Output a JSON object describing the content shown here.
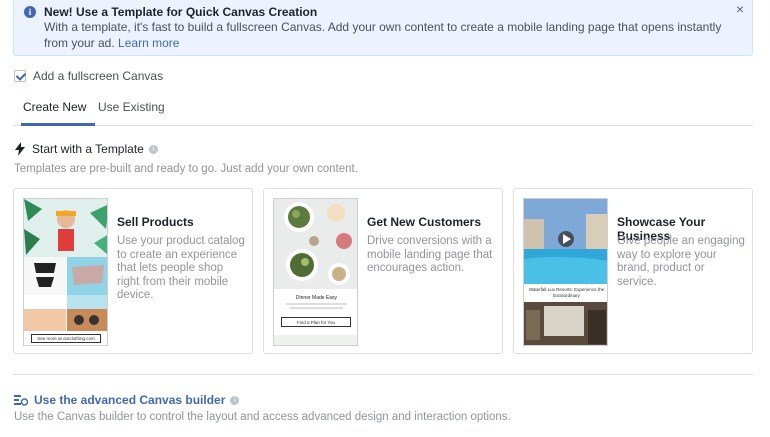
{
  "banner": {
    "title": "New! Use a Template for Quick Canvas Creation",
    "body": "With a template, it's fast to build a fullscreen Canvas. Add your own content to create a mobile landing page that opens instantly from your ad.",
    "link": "Learn more",
    "close": "×"
  },
  "checkbox": {
    "label": "Add a fullscreen Canvas",
    "checked": true
  },
  "tabs": [
    {
      "label": "Create New",
      "active": true
    },
    {
      "label": "Use Existing",
      "active": false
    }
  ],
  "templates_section": {
    "title": "Start with a Template",
    "subtitle": "Templates are pre-built and ready to go. Just add your own content."
  },
  "cards": [
    {
      "title": "Sell Products",
      "desc": "Use your product catalog to create an experience that lets people shop right from their mobile device.",
      "thumb_button": "See more at ourclothing.com"
    },
    {
      "title": "Get New Customers",
      "desc": "Drive conversions with a mobile landing page that encourages action.",
      "thumb_heading": "Dinner Made Easy",
      "thumb_button": "Find a Plan for You"
    },
    {
      "title": "Showcase Your Business",
      "desc": "Give people an engaging way to explore your brand, product or service.",
      "thumb_caption": "Waterfall Lux Resorts: Experience the Extraordinary"
    }
  ],
  "advanced": {
    "title": "Use the advanced Canvas builder",
    "subtitle": "Use the Canvas builder to control the layout and access advanced design and interaction options."
  },
  "colors": {
    "accent": "#4267b2",
    "banner_bg": "#ecf3ff",
    "muted": "#90949c"
  }
}
